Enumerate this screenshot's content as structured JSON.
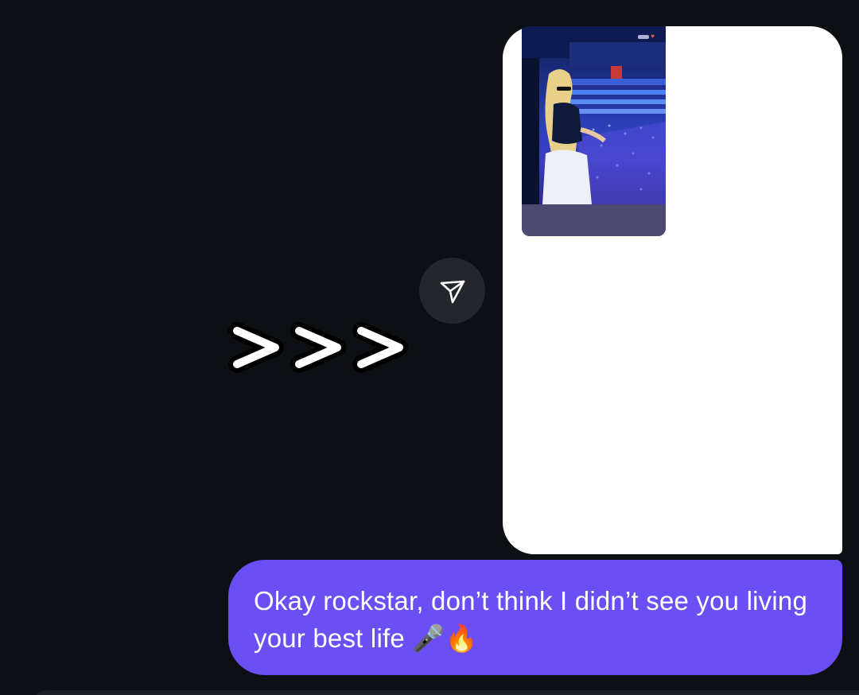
{
  "conversation": {
    "shared_story": {
      "preview_icon": "story-preview-image",
      "badge_icon": "heart-icon",
      "badge_color": "#ff5a3c"
    },
    "share_button": {
      "icon": "paper-plane-icon"
    },
    "sticker": {
      "text": ">>>"
    },
    "message": {
      "text": "Okay rockstar, don’t think I didn’t see you living your best life 🎤🔥",
      "bubble_color": "#6c4ef5"
    }
  },
  "theme": {
    "background": "#0c0f14",
    "card_background": "#ffffff",
    "story_footer": "#4c4a72",
    "share_button_bg": "#23262c"
  }
}
